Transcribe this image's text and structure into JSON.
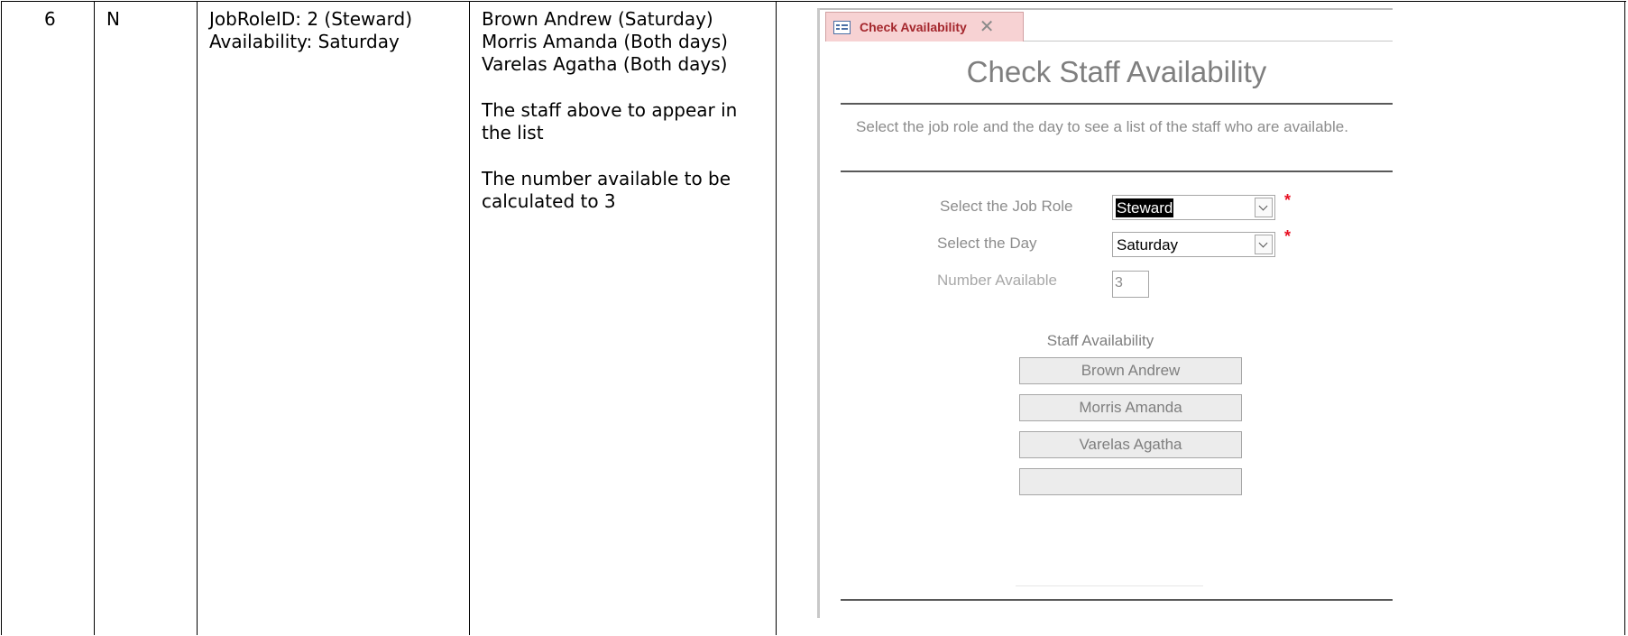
{
  "row": {
    "test_no": "6",
    "type": "N",
    "test_data": [
      "JobRoleID: 2 (Steward)",
      "Availability: Saturday"
    ],
    "expected_names": [
      "Brown Andrew (Saturday)",
      "Morris Amanda (Both days)",
      "Varelas Agatha (Both days)"
    ],
    "expected_note_1": "The staff above to appear in the list",
    "expected_note_2": "The number available to be calculated to 3"
  },
  "form": {
    "tab_label": "Check Availability",
    "tab_close": "✕",
    "title": "Check Staff Availability",
    "instructions": "Select the job role and the day to see a list of the staff who are available.",
    "job_role_label": "Select the Job Role",
    "job_role_value": "Steward",
    "day_label": "Select the Day",
    "day_value": "Saturday",
    "required_mark": "*",
    "number_label": "Number Available",
    "number_value": "3",
    "list_title": "Staff Availability",
    "staff": [
      "Brown Andrew",
      "Morris Amanda",
      "Varelas Agatha",
      ""
    ]
  },
  "colors": {
    "tab_background": "#f7d2d3",
    "tab_text": "#a4262c",
    "required": "#e81123",
    "form_text": "#8c8c8c"
  },
  "icons": [
    "form-icon",
    "close-icon",
    "chevron-down-icon"
  ]
}
